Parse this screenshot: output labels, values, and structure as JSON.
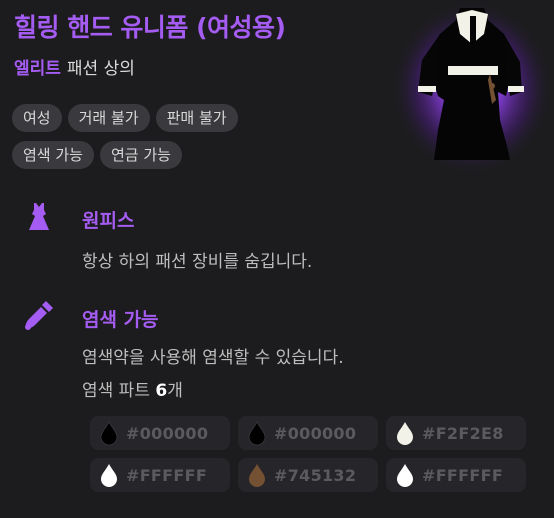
{
  "item": {
    "title": "힐링 핸드 유니폼 (여성용)",
    "grade": "엘리트",
    "category": "패션 상의"
  },
  "tags": [
    [
      "여성",
      "거래 불가",
      "판매 불가"
    ],
    [
      "염색 가능",
      "연금 가능"
    ]
  ],
  "sections": {
    "onepiece": {
      "icon": "dress-icon",
      "title": "원피스",
      "text": "항상 하의 패션 장비를 숨깁니다."
    },
    "dye": {
      "icon": "dye-brush-icon",
      "title": "염색 가능",
      "text": "염색약을 사용해 염색할 수 있습니다.",
      "parts_label": "염색 파트",
      "parts_count": "6",
      "parts_suffix": "개"
    }
  },
  "dye_colors": [
    {
      "hex": "#000000",
      "color": "#000000"
    },
    {
      "hex": "#000000",
      "color": "#000000"
    },
    {
      "hex": "#F2F2E8",
      "color": "#F2F2E8"
    },
    {
      "hex": "#FFFFFF",
      "color": "#FFFFFF"
    },
    {
      "hex": "#745132",
      "color": "#745132"
    },
    {
      "hex": "#FFFFFF",
      "color": "#FFFFFF"
    }
  ],
  "accent_color": "#a55cf2"
}
